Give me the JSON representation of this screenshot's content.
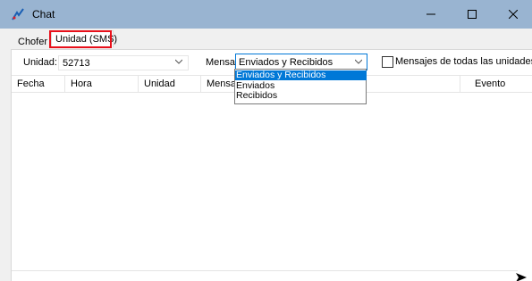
{
  "window": {
    "title": "Chat"
  },
  "tabs": [
    {
      "label": "Chofer"
    },
    {
      "label": "Unidad (SMS)"
    }
  ],
  "filters": {
    "unidad_label": "Unidad:",
    "unidad_value": "52713",
    "mensajes_label": "Mensajes:",
    "mensajes_value": "Enviados y Recibidos",
    "all_units_label": "Mensajes de todas las unidades",
    "all_units_checked": false
  },
  "dropdown": {
    "options": [
      "Enviados y Recibidos",
      "Enviados",
      "Recibidos"
    ],
    "selected_index": 0
  },
  "grid": {
    "columns": [
      "Fecha",
      "Hora",
      "Unidad",
      "Mensaje",
      "Evento"
    ]
  },
  "colors": {
    "titlebar": "#99b4d1",
    "highlight": "#e8101a",
    "selection": "#0078d7"
  }
}
